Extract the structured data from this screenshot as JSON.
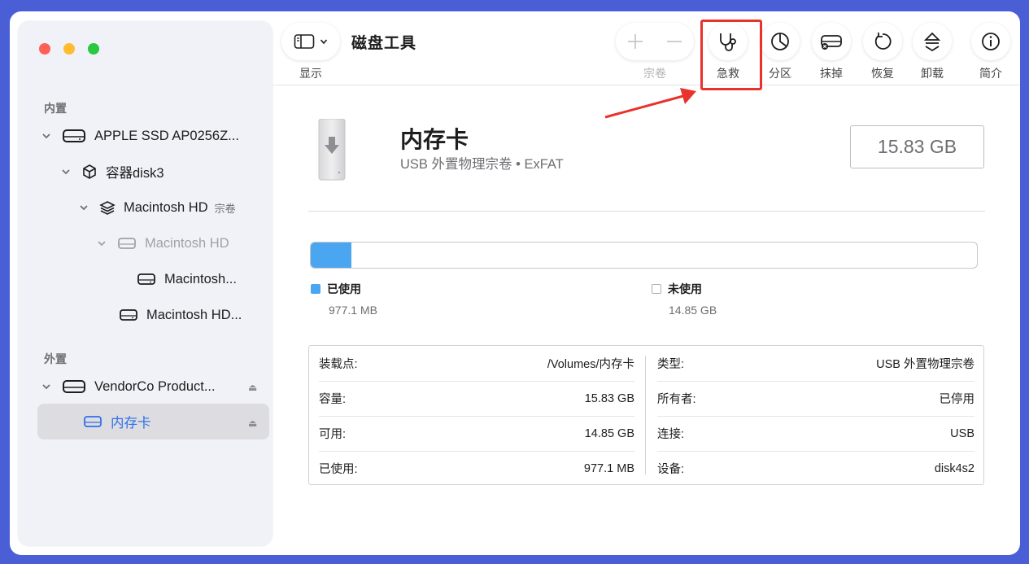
{
  "app": {
    "title": "磁盘工具"
  },
  "toolbar": {
    "view_label": "显示",
    "volume_label": "宗卷",
    "first_aid_label": "急救",
    "partition_label": "分区",
    "erase_label": "抹掉",
    "restore_label": "恢复",
    "unmount_label": "卸载",
    "info_label": "简介"
  },
  "sidebar": {
    "internal_header": "内置",
    "external_header": "外置",
    "items": [
      {
        "label": "APPLE SSD AP0256Z..."
      },
      {
        "label": "容器disk3"
      },
      {
        "label": "Macintosh HD",
        "sub": "宗卷"
      },
      {
        "label": "Macintosh HD"
      },
      {
        "label": "Macintosh..."
      },
      {
        "label": "Macintosh HD..."
      },
      {
        "label": "VendorCo Product..."
      },
      {
        "label": "内存卡"
      }
    ]
  },
  "volume": {
    "name": "内存卡",
    "description": "USB 外置物理宗卷 • ExFAT",
    "capacity": "15.83 GB"
  },
  "usage": {
    "used_fraction": 0.061,
    "used_label": "已使用",
    "used_value": "977.1 MB",
    "free_label": "未使用",
    "free_value": "14.85 GB",
    "used_color": "#4aa6f0"
  },
  "info": {
    "left": [
      {
        "key": "装载点:",
        "value": "/Volumes/内存卡"
      },
      {
        "key": "容量:",
        "value": "15.83 GB"
      },
      {
        "key": "可用:",
        "value": "14.85 GB"
      },
      {
        "key": "已使用:",
        "value": "977.1 MB"
      }
    ],
    "right": [
      {
        "key": "类型:",
        "value": "USB 外置物理宗卷"
      },
      {
        "key": "所有者:",
        "value": "已停用"
      },
      {
        "key": "连接:",
        "value": "USB"
      },
      {
        "key": "设备:",
        "value": "disk4s2"
      }
    ]
  },
  "colors": {
    "accent": "#2f6fea",
    "highlight": "#e8322b"
  }
}
